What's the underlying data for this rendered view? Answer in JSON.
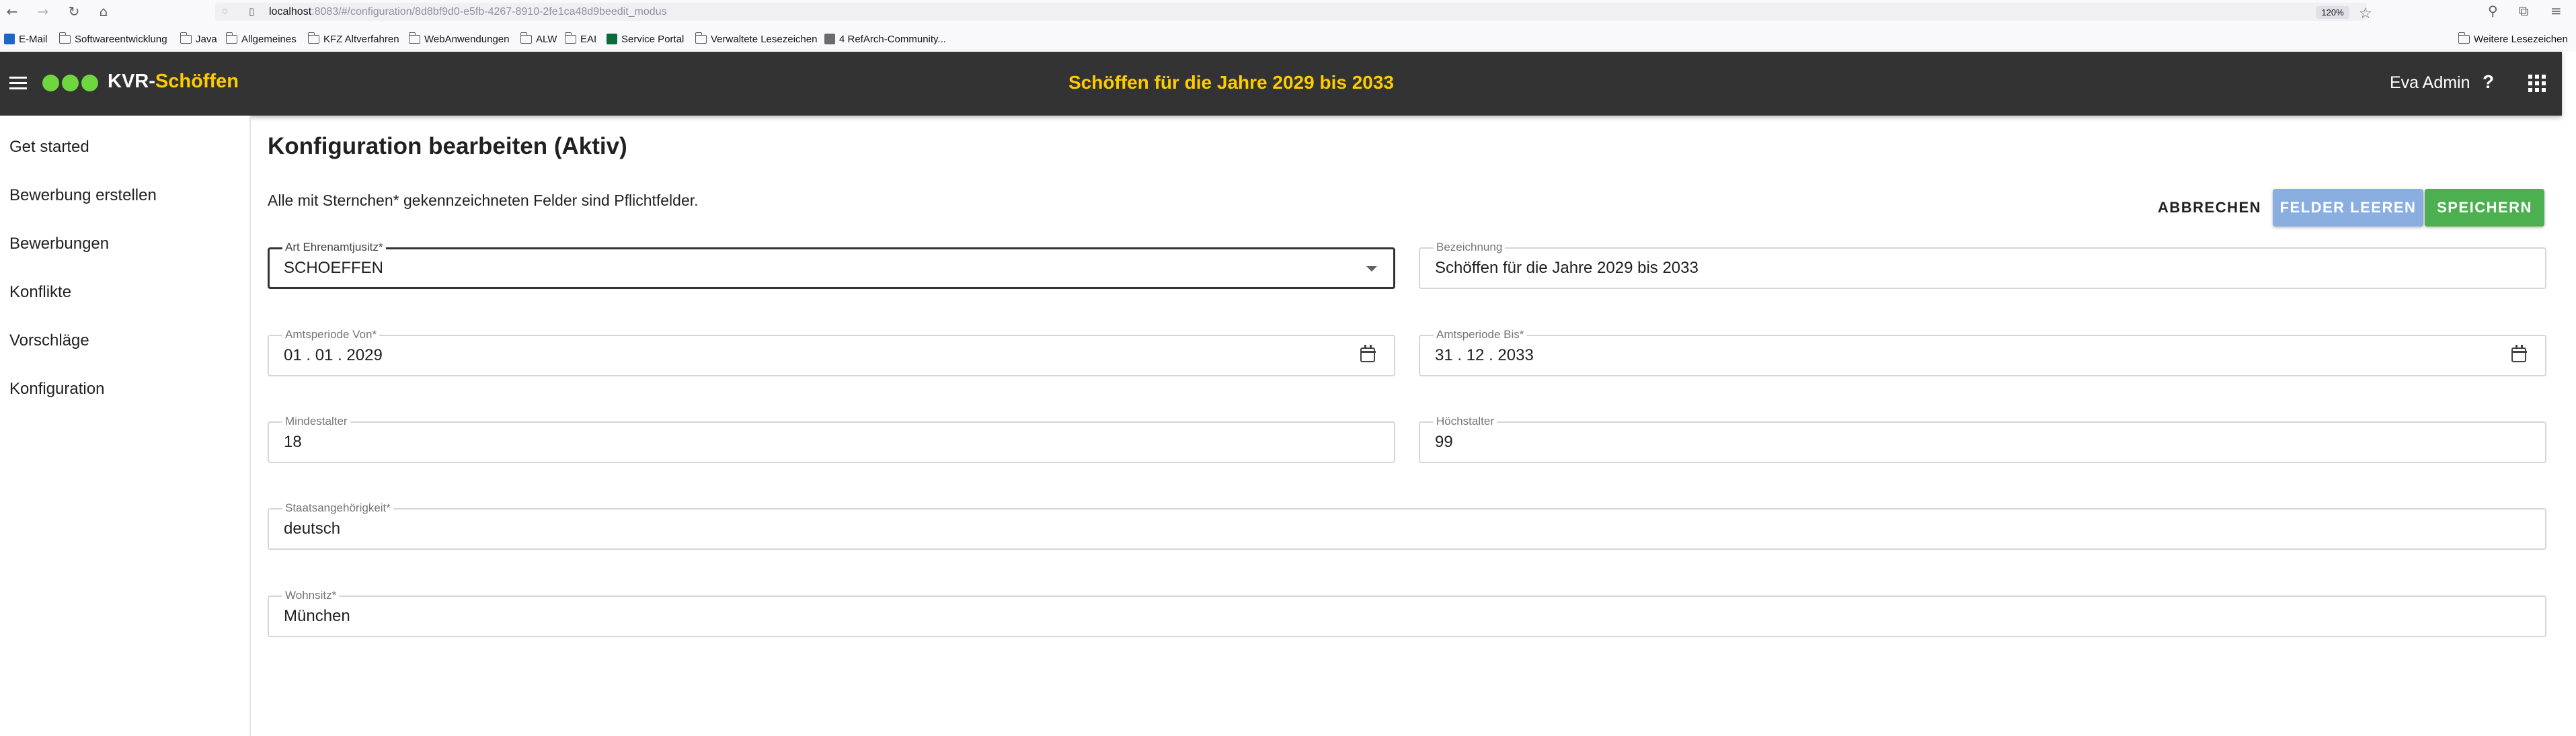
{
  "browser": {
    "back_icon": "arrow-left-icon",
    "forward_icon": "arrow-right-icon",
    "reload_icon": "reload-icon",
    "home_icon": "home-icon",
    "url_host": "localhost",
    "url_rest": ":8083/#/configuration/8d8bf9d0-e5fb-4267-8910-2fe1ca48d9beedit_modus",
    "zoom": "120%",
    "bookmarks": [
      {
        "label": "E-Mail",
        "icon": "outlook-icon"
      },
      {
        "label": "Softwareentwicklung",
        "icon": "folder-icon"
      },
      {
        "label": "Java",
        "icon": "folder-icon"
      },
      {
        "label": "Allgemeines",
        "icon": "folder-icon"
      },
      {
        "label": "KFZ Altverfahren",
        "icon": "folder-icon"
      },
      {
        "label": "WebAnwendungen",
        "icon": "folder-icon"
      },
      {
        "label": "ALW",
        "icon": "folder-icon"
      },
      {
        "label": "EAI",
        "icon": "folder-icon"
      },
      {
        "label": "Service Portal",
        "icon": "service-portal-icon"
      },
      {
        "label": "Verwaltete Lesezeichen",
        "icon": "folder-icon"
      },
      {
        "label": "4 RefArch-Community...",
        "icon": "bookmark-icon"
      }
    ],
    "other_bookmarks": "Weitere Lesezeichen"
  },
  "header": {
    "brand_part1": "KVR-",
    "brand_part2": "Schöffen",
    "title": "Schöffen für die Jahre 2029 bis 2033",
    "user": "Eva Admin",
    "help": "?"
  },
  "sidebar": {
    "items": [
      {
        "label": "Get started"
      },
      {
        "label": "Bewerbung erstellen"
      },
      {
        "label": "Bewerbungen"
      },
      {
        "label": "Konflikte"
      },
      {
        "label": "Vorschläge"
      },
      {
        "label": "Konfiguration"
      }
    ]
  },
  "main": {
    "title": "Konfiguration bearbeiten (Aktiv)",
    "required_note": "Alle mit Sternchen* gekennzeichneten Felder sind Pflichtfelder.",
    "buttons": {
      "cancel": "ABBRECHEN",
      "clear": "FELDER LEEREN",
      "save": "SPEICHERN"
    },
    "fields": {
      "art": {
        "label": "Art Ehrenamtjusitz*",
        "value": "SCHOEFFEN"
      },
      "bezeichnung": {
        "label": "Bezeichnung",
        "value": "Schöffen für die Jahre 2029 bis 2033"
      },
      "von": {
        "label": "Amtsperiode Von*",
        "value": "01 . 01 . 2029"
      },
      "bis": {
        "label": "Amtsperiode Bis*",
        "value": "31 . 12 . 2033"
      },
      "mindestalter": {
        "label": "Mindestalter",
        "value": "18"
      },
      "hoechstalter": {
        "label": "Höchstalter",
        "value": "99"
      },
      "staat": {
        "label": "Staatsangehörigkeit*",
        "value": "deutsch"
      },
      "wohnsitz": {
        "label": "Wohnsitz*",
        "value": "München"
      }
    }
  },
  "colors": {
    "header_bg": "#333333",
    "brand_accent": "#ffcc00",
    "logo_dots": "#6ed63f",
    "save_button": "#4caf50",
    "clear_button": "#8aaee0"
  }
}
